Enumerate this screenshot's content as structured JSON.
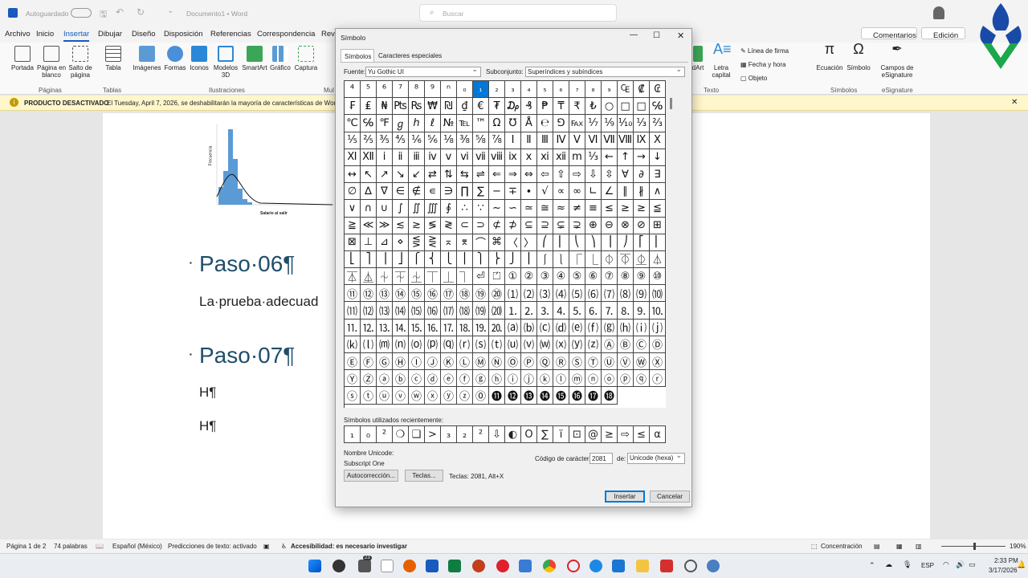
{
  "titlebar": {
    "autosave": "Autoguardado",
    "doc_title": "Documento1 • Word",
    "search_placeholder": "Buscar"
  },
  "tabs": [
    "Archivo",
    "Inicio",
    "Insertar",
    "Dibujar",
    "Diseño",
    "Disposición",
    "Referencias",
    "Correspondencia",
    "Revi"
  ],
  "tabs_right": {
    "comments": "Comentarios",
    "edit": "Edición"
  },
  "ribbon": {
    "portada": "Portada",
    "pagina_blanco": "Página en blanco",
    "salto": "Salto de página",
    "tabla": "Tabla",
    "imagenes": "Imágenes",
    "formas": "Formas",
    "iconos": "Iconos",
    "modelos": "Modelos 3D",
    "smartart": "SmartArt",
    "grafico": "Gráfico",
    "captura": "Captura",
    "g_paginas": "Páginas",
    "g_tablas": "Tablas",
    "g_ilustraciones": "Ilustraciones",
    "g_mul": "Mul",
    "smartart_r": "dArt",
    "letra_capital": "Letra capital",
    "linea_firma": "Línea de firma",
    "fecha_hora": "Fecha y hora",
    "objeto": "Objeto",
    "g_texto": "Texto",
    "ecuacion": "Ecuación",
    "simbolo": "Símbolo",
    "g_simbolos": "Símbolos",
    "campos": "Campos de eSignature",
    "g_esig": "eSignature"
  },
  "infobar": {
    "title": "PRODUCTO DESACTIVADO",
    "message": "El Tuesday, April 7, 2026, se deshabilitarán la mayoría de características de Word."
  },
  "document": {
    "heading1": "Paso·06¶",
    "para1": "La·prueba·adecuad",
    "heading2": "Paso·07¶",
    "line1": "H¶",
    "line2": "H¶",
    "chart_ylabel": "Frecuencia",
    "chart_xlabel": "Salario al salir"
  },
  "dialog": {
    "title": "Símbolo",
    "tab_symbols": "Símbolos",
    "tab_special": "Caracteres especiales",
    "font_label": "Fuente:",
    "font_value": "Yu Gothic UI",
    "subset_label": "Subconjunto:",
    "subset_value": "Superíndices y subíndices",
    "grid": [
      [
        "⁴",
        "⁵",
        "⁶",
        "⁷",
        "⁸",
        "⁹",
        "ⁿ",
        "₀",
        "₁",
        "₂",
        "₃",
        "₄",
        "₅",
        "₆",
        "₇",
        "₈",
        "₉",
        "₠",
        "₡",
        "₢"
      ],
      [
        "₣",
        "₤",
        "₦",
        "₧",
        "₨",
        "₩",
        "₪",
        "₫",
        "€",
        "₮",
        "₯",
        "₰",
        "₱",
        "₸",
        "₹",
        "₺",
        "○",
        "□",
        "□",
        "℅"
      ],
      [
        "℃",
        "℅",
        "℉",
        "ℊ",
        "ℎ",
        "ℓ",
        "№",
        "℡",
        "™",
        "Ω",
        "℧",
        "Å",
        "℮",
        "⅁",
        "℻",
        "⅐",
        "⅑",
        "⅒",
        "⅓",
        "⅔"
      ],
      [
        "⅕",
        "⅖",
        "⅗",
        "⅘",
        "⅙",
        "⅚",
        "⅛",
        "⅜",
        "⅝",
        "⅞",
        "Ⅰ",
        "Ⅱ",
        "Ⅲ",
        "Ⅳ",
        "Ⅴ",
        "Ⅵ",
        "Ⅶ",
        "Ⅷ",
        "Ⅸ",
        "Ⅹ"
      ],
      [
        "Ⅺ",
        "Ⅻ",
        "ⅰ",
        "ⅱ",
        "ⅲ",
        "ⅳ",
        "ⅴ",
        "ⅵ",
        "ⅶ",
        "ⅷ",
        "ⅸ",
        "ⅹ",
        "ⅺ",
        "ⅻ",
        "ⅿ",
        "⅓",
        "←",
        "↑",
        "→",
        "↓"
      ],
      [
        "↔",
        "↖",
        "↗",
        "↘",
        "↙",
        "⇄",
        "⇅",
        "⇆",
        "⇌",
        "⇐",
        "⇒",
        "⇔",
        "⇦",
        "⇧",
        "⇨",
        "⇩",
        "⇳",
        "∀",
        "∂"
      ],
      [
        "∃",
        "∅",
        "∆",
        "∇",
        "∈",
        "∉",
        "∊",
        "∋",
        "∏",
        "∑",
        "−",
        "∓",
        "∙",
        "√",
        "∝",
        "∞",
        "∟",
        "∠",
        "∥",
        "∦"
      ],
      [
        "∧",
        "∨",
        "∩",
        "∪",
        "∫",
        "∬",
        "∭",
        "∮",
        "∴",
        "∵",
        "∼",
        "∽",
        "≃",
        "≅",
        "≈",
        "≠",
        "≡",
        "≤",
        "≥"
      ],
      [
        "≥",
        "≦",
        "≧",
        "≪",
        "≫",
        "≲",
        "≳",
        "≶",
        "≷",
        "⊂",
        "⊃",
        "⊄",
        "⊅",
        "⊆",
        "⊇",
        "⊊",
        "⊋",
        "⊕",
        "⊖",
        "⊗"
      ],
      [
        "⊘",
        "⊞",
        "⊠",
        "⊥",
        "⊿",
        "⋄",
        "⋚",
        "⋛",
        "⌅",
        "⌆",
        "⌒",
        "⌘",
        "〈",
        "〉",
        "⎛",
        "⎜",
        "⎝",
        "⎞",
        "⎟",
        "⎠"
      ],
      [
        "⎡",
        "⎢",
        "⎣",
        "⎤",
        "⎥",
        "⎦",
        "⎧",
        "⎨",
        "⎩",
        "⎪",
        "⎫",
        "⎬",
        "⎭",
        "⎮",
        "⎰",
        "⎱",
        "⎾",
        "⎿",
        "⏀",
        "⏁"
      ],
      [
        "⏂",
        "⏃",
        "⏄",
        "⏅",
        "⏆",
        "⏇",
        "⏈",
        "⏉",
        "⏊",
        "⏋",
        "⏎",
        "⏍",
        "①",
        "②",
        "③",
        "④",
        "⑤",
        "⑥",
        "⑦"
      ],
      [
        "⑧",
        "⑨",
        "⑩",
        "⑪",
        "⑫",
        "⑬",
        "⑭",
        "⑮",
        "⑯",
        "⑰",
        "⑱",
        "⑲",
        "⑳",
        "⑴",
        "⑵",
        "⑶",
        "⑷",
        "⑸",
        "⑹",
        "⑺"
      ],
      [
        "⑻",
        "⑼",
        "⑽",
        "⑾",
        "⑿",
        "⒀",
        "⒁",
        "⒂",
        "⒃",
        "⒄",
        "⒅",
        "⒆",
        "⒇",
        "⒈",
        "⒉",
        "⒊",
        "⒋",
        "⒌",
        "⒍",
        "⒎"
      ],
      [
        "⒏",
        "⒐",
        "⒑",
        "⒒",
        "⒓",
        "⒔",
        "⒕",
        "⒖",
        "⒗",
        "⒘",
        "⒙",
        "⒚",
        "⒛",
        "⒜",
        "⒝",
        "⒞",
        "⒟",
        "⒠",
        "⒡",
        "⒢"
      ],
      [
        "⒣",
        "⒤",
        "⒥",
        "⒦",
        "⒧",
        "⒨",
        "⒩",
        "⒪",
        "⒫",
        "⒬",
        "⒭",
        "⒮",
        "⒯",
        "⒰",
        "⒱",
        "⒲",
        "⒳",
        "⒴",
        "⒵",
        "Ⓐ"
      ],
      [
        "Ⓑ",
        "Ⓒ",
        "Ⓓ",
        "Ⓔ",
        "Ⓕ",
        "Ⓖ",
        "Ⓗ",
        "Ⓘ",
        "Ⓙ",
        "Ⓚ",
        "Ⓛ",
        "Ⓜ",
        "Ⓝ",
        "Ⓞ",
        "Ⓟ",
        "Ⓠ",
        "Ⓡ",
        "Ⓢ",
        "Ⓣ",
        "Ⓤ"
      ],
      [
        "Ⓥ",
        "Ⓦ",
        "Ⓧ",
        "Ⓨ",
        "Ⓩ",
        "ⓐ",
        "ⓑ",
        "ⓒ",
        "ⓓ",
        "ⓔ",
        "ⓕ",
        "ⓖ",
        "ⓗ",
        "ⓘ",
        "ⓙ",
        "ⓚ",
        "ⓛ",
        "ⓜ",
        "ⓝ",
        "ⓞ"
      ],
      [
        "ⓟ",
        "ⓠ",
        "ⓡ",
        "ⓢ",
        "ⓣ",
        "ⓤ",
        "ⓥ",
        "ⓦ",
        "ⓧ",
        "ⓨ",
        "ⓩ",
        "⓪",
        "⓫",
        "⓬",
        "⓭",
        "⓮",
        "⓯",
        "⓰",
        "⓱",
        "⓲"
      ]
    ],
    "recent_label": "Símbolos utilizados recientemente:",
    "recent": [
      "₁",
      "₀",
      "²",
      "❍",
      "❑",
      ">",
      "₃",
      "₂",
      "²",
      "⇩",
      "◐",
      "O",
      "∑",
      "ï",
      "⊡",
      "@",
      "≥",
      "⇨",
      "≤",
      "α"
    ],
    "unicode_name_label": "Nombre Unicode:",
    "unicode_name": "Subscript One",
    "code_label": "Código de carácter:",
    "code_value": "2081",
    "from_label": "de:",
    "from_value": "Unicode (hexa)",
    "autocorrect": "Autocorrección...",
    "keys_btn": "Teclas...",
    "keys_text": "Teclas: 2081, Alt+X",
    "insert": "Insertar",
    "cancel": "Cancelar"
  },
  "statusbar": {
    "page": "Página 1 de 2",
    "words": "74 palabras",
    "language": "Español (México)",
    "predictions": "Predicciones de texto: activado",
    "accessibility": "Accesibilidad: es necesario investigar",
    "focus": "Concentración",
    "zoom": "190%"
  },
  "taskbar": {
    "badge": "23",
    "lang": "ESP",
    "time": "2:33 PM",
    "date": "3/17/2026"
  },
  "colors": {
    "accent": "#0078d7",
    "word_blue": "#185abd",
    "heading": "#1f4e6b"
  }
}
